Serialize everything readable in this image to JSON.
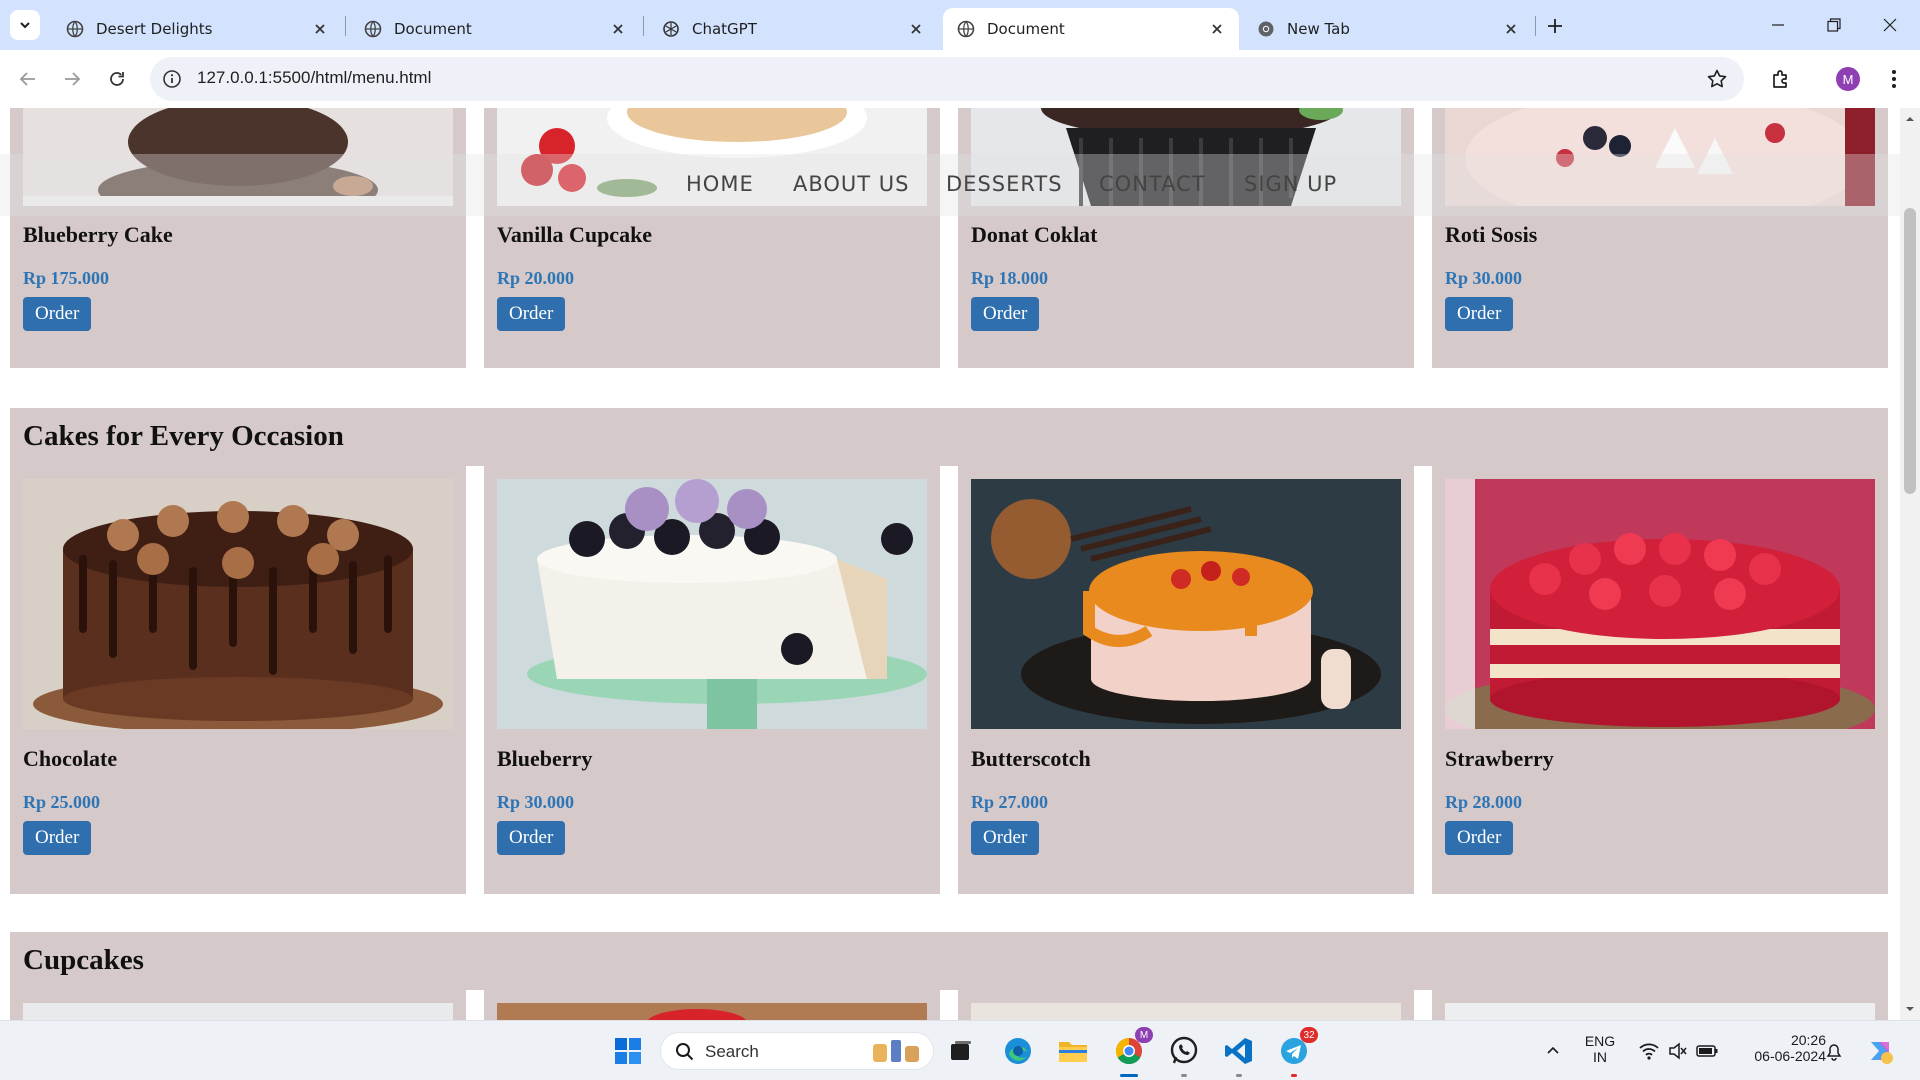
{
  "browser": {
    "tabs": [
      {
        "label": "Desert Delights",
        "active": false
      },
      {
        "label": "Document",
        "active": false
      },
      {
        "label": "ChatGPT",
        "active": false
      },
      {
        "label": "Document",
        "active": true
      },
      {
        "label": "New Tab",
        "active": false
      }
    ],
    "url": "127.0.0.1:5500/html/menu.html",
    "profile_initial": "M"
  },
  "site_nav": [
    "HOME",
    "ABOUT US",
    "DESSERTS",
    "CONTACT",
    "SIGN UP"
  ],
  "top_row": [
    {
      "name": "Blueberry Cake",
      "price": "Rp 175.000",
      "button": "Order"
    },
    {
      "name": "Vanilla Cupcake",
      "price": "Rp 20.000",
      "button": "Order"
    },
    {
      "name": "Donat Coklat",
      "price": "Rp 18.000",
      "button": "Order"
    },
    {
      "name": "Roti Sosis",
      "price": "Rp 30.000",
      "button": "Order"
    }
  ],
  "cakes_section": {
    "title": "Cakes for Every Occasion",
    "items": [
      {
        "name": "Chocolate",
        "price": "Rp 25.000",
        "button": "Order"
      },
      {
        "name": "Blueberry",
        "price": "Rp 30.000",
        "button": "Order"
      },
      {
        "name": "Butterscotch",
        "price": "Rp 27.000",
        "button": "Order"
      },
      {
        "name": "Strawberry",
        "price": "Rp 28.000",
        "button": "Order"
      }
    ]
  },
  "cupcakes_section": {
    "title": "Cupcakes"
  },
  "taskbar": {
    "search_label": "Search",
    "telegram_badge": "32",
    "chrome_badge": "M",
    "lang_line1": "ENG",
    "lang_line2": "IN",
    "time": "20:26",
    "date": "06-06-2024"
  },
  "colors": {
    "card_bg": "#d5c9c9",
    "price": "#2e75b6",
    "button": "#2f6fad",
    "tabstrip": "#d3e3fd"
  }
}
